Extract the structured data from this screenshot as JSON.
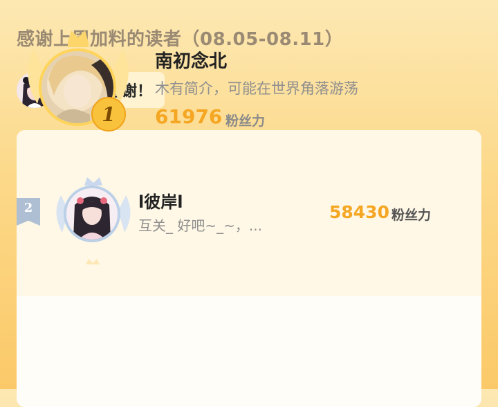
{
  "header": {
    "title": "感谢上周加料的读者（08.05-08.11）"
  },
  "thanks": {
    "message": "非常感谢！"
  },
  "leaderboard": [
    {
      "rank": "1",
      "name": "南初念北",
      "bio": "木有简介，可能在世界角落游荡",
      "fans": "61976",
      "unit": "粉丝力"
    },
    {
      "rank": "2",
      "name": "l彼岸l",
      "bio": "互关_ 好吧~_~，...",
      "fans": "58430",
      "unit": "粉丝力"
    }
  ],
  "colors": {
    "accent": "#f5a623",
    "background_top": "#fde8b3",
    "background_bottom": "#fbc968"
  },
  "icons": {
    "rank1": "gold-crown-wings",
    "rank2": "silver-crown-wings"
  }
}
